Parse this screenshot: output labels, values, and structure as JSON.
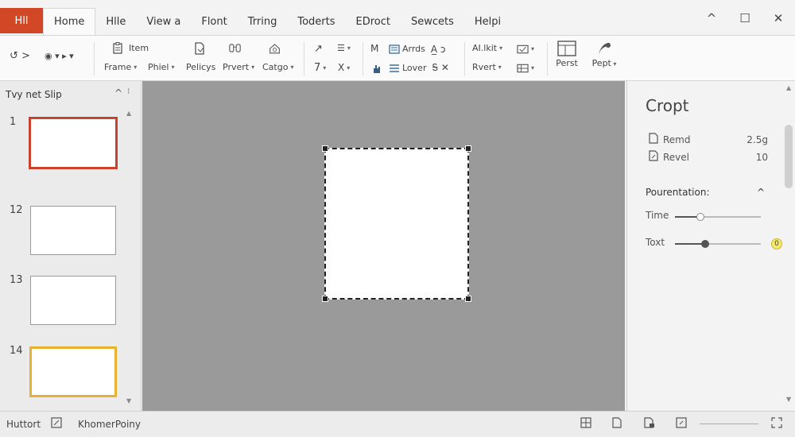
{
  "app": {
    "badge": "Hll"
  },
  "tabs": [
    "Home",
    "Hlle",
    "View a",
    "Flont",
    "Trring",
    "Toderts",
    "EDroct",
    "Sewcets",
    "Helpi"
  ],
  "window_controls": {
    "minimize": "^",
    "maximize": "☐",
    "close": "✕"
  },
  "ribbon": {
    "undo": {
      "label": "↺ >",
      "icon": "undo-icon"
    },
    "redo_label": "◉ ▾ ▸ ▾",
    "frame": {
      "top": "Item",
      "bottom": "Frame"
    },
    "pixel": "Phiel",
    "policy": "Pelicys",
    "pivot": "Prvert",
    "catgo": "Catgo",
    "line_top": "↗",
    "line_bottom": "7",
    "list_top": "☰",
    "list_bottom": "X",
    "m_letter": "M",
    "arrds": "Arrds",
    "lover": "Lover",
    "alist": "AI.lkit",
    "rvert": "Rvert",
    "perst": "Perst",
    "pept": "Pept"
  },
  "slides_panel": {
    "title": "Tvy net Slip",
    "slides": [
      {
        "num": "1",
        "state": "selected-red"
      },
      {
        "num": "12",
        "state": "normal"
      },
      {
        "num": "13",
        "state": "normal"
      },
      {
        "num": "14",
        "state": "selected-yellow"
      }
    ]
  },
  "crop_pane": {
    "title": "Cropt",
    "rows": [
      {
        "label": "Remd",
        "value": "2.5g",
        "icon": "page-icon"
      },
      {
        "label": "Revel",
        "value": "10",
        "icon": "page-edit-icon"
      }
    ],
    "section": "Pourentation:",
    "sliders": [
      {
        "label": "Time",
        "level": 0.3
      },
      {
        "label": "Toxt",
        "level": 0.35,
        "badge": "0"
      }
    ]
  },
  "status": {
    "left": "Huttort",
    "middle": "KhomerPoiny"
  }
}
